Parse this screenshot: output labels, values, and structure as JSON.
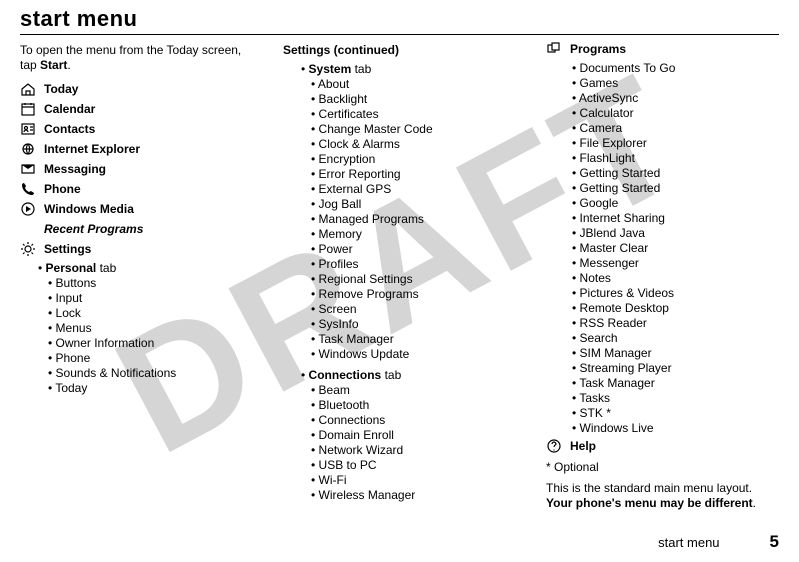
{
  "watermark": "DRAFT",
  "title": "start menu",
  "intro_pre": "To open the menu from the Today screen, tap ",
  "intro_bold": "Start",
  "intro_post": ".",
  "menu": [
    {
      "icon": "home",
      "label": "Today"
    },
    {
      "icon": "calendar",
      "label": "Calendar"
    },
    {
      "icon": "contacts",
      "label": "Contacts"
    },
    {
      "icon": "ie",
      "label": "Internet Explorer"
    },
    {
      "icon": "mail",
      "label": "Messaging"
    },
    {
      "icon": "phone",
      "label": "Phone"
    },
    {
      "icon": "wm",
      "label": "Windows Media"
    }
  ],
  "recent_label": "Recent Programs",
  "settings_label": "Settings",
  "personal": {
    "tab": "Personal",
    "items": [
      "Buttons",
      "Input",
      "Lock",
      "Menus",
      "Owner Information",
      "Phone",
      "Sounds & Notifications",
      "Today"
    ]
  },
  "settings_cont": "Settings (continued)",
  "system": {
    "tab": "System",
    "items": [
      "About",
      "Backlight",
      "Certificates",
      "Change Master Code",
      "Clock & Alarms",
      "Encryption",
      "Error Reporting",
      "External GPS",
      "Jog Ball",
      "Managed Programs",
      "Memory",
      "Power",
      "Profiles",
      "Regional Settings",
      "Remove Programs",
      "Screen",
      "SysInfo",
      "Task Manager",
      "Windows Update"
    ]
  },
  "connections": {
    "tab": "Connections",
    "items": [
      "Beam",
      "Bluetooth",
      "Connections",
      "Domain Enroll",
      "Network Wizard",
      "USB to PC",
      "Wi-Fi",
      "Wireless Manager"
    ]
  },
  "programs": {
    "label": "Programs",
    "items": [
      "Documents To Go",
      "Games",
      "ActiveSync",
      "Calculator",
      "Camera",
      "File Explorer",
      "FlashLight",
      "Getting Started",
      "Getting Started",
      "Google",
      "Internet Sharing",
      "JBlend Java",
      "Master Clear",
      "Messenger",
      "Notes",
      "Pictures & Videos",
      "Remote Desktop",
      "RSS Reader",
      "Search",
      "SIM Manager",
      "Streaming Player",
      "Task Manager",
      "Tasks",
      "STK *",
      "Windows Live"
    ]
  },
  "help_label": "Help",
  "optional_note": "* Optional",
  "closing_pre": "This is the standard main menu layout. ",
  "closing_bold": "Your phone's menu may be different",
  "closing_post": ".",
  "footer_label": "start menu",
  "footer_page": "5"
}
